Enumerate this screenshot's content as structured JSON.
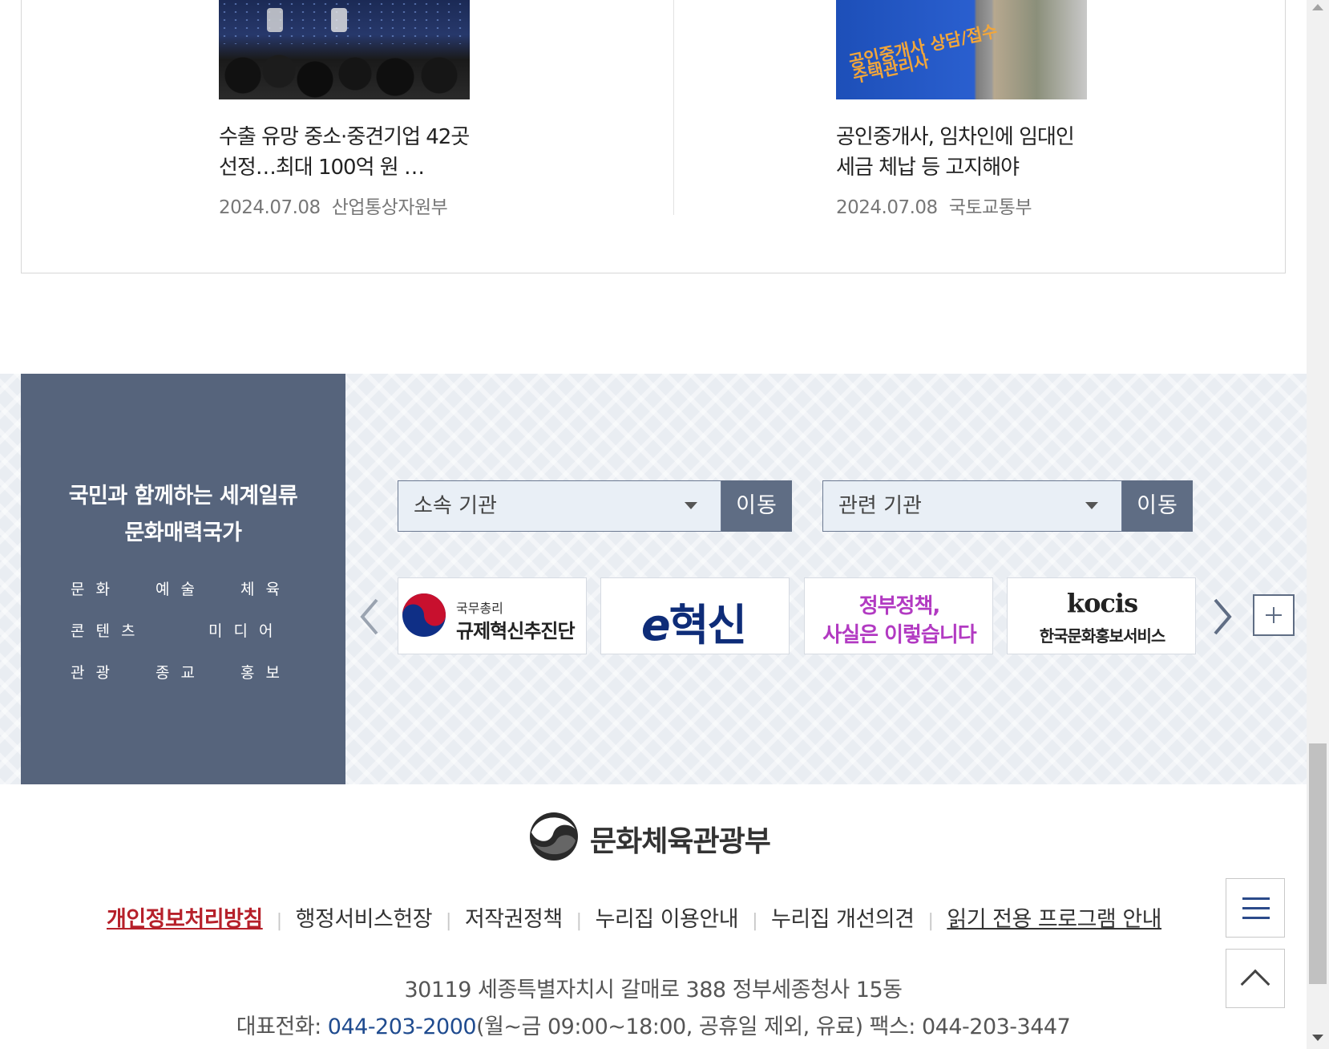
{
  "news": {
    "items": [
      {
        "title": "수출 유망 중소·중견기업 42곳 선정…최대 100억 원 …",
        "date": "2024.07.08",
        "source": "산업통상자원부"
      },
      {
        "title": "공인중개사, 임차인에 임대인 세금 체납 등 고지해야",
        "date": "2024.07.08",
        "source": "국토교통부",
        "image_sign_line1": "공인중개사 상담/접수",
        "image_sign_line2": "주택관리사"
      }
    ]
  },
  "slogan": {
    "line1": "국민과 함께하는 세계일류",
    "line2": "문화매력국가",
    "keywords": {
      "row1": [
        "문화",
        "예술",
        "체육"
      ],
      "row2": [
        "콘텐츠",
        "미디어"
      ],
      "row3": [
        "관광",
        "종교",
        "홍보"
      ]
    }
  },
  "selects": {
    "affiliated": {
      "value": "소속 기관",
      "button": "이동"
    },
    "related": {
      "value": "관련 기관",
      "button": "이동"
    }
  },
  "banners": {
    "b1": {
      "small": "국무총리",
      "big": "규제혁신추진단"
    },
    "b2": {
      "e": "e",
      "text": "혁신"
    },
    "b3": {
      "line1": "정부정책,",
      "line2": "사실은 이렇습니다"
    },
    "b4": {
      "logo": "kocis",
      "sub": "한국문화홍보서비스"
    }
  },
  "footer": {
    "ministry": "문화체육관광부",
    "links": {
      "privacy": "개인정보처리방침",
      "service": "행정서비스헌장",
      "copyright": "저작권정책",
      "usage": "누리집 이용안내",
      "feedback": "누리집 개선의견",
      "reader": "읽기 전용 프로그램 안내"
    },
    "address": "30119 세종특별자치시 갈매로 388 정부세종청사 15동",
    "tel_label": "대표전화: ",
    "tel_number": "044-203-2000",
    "tel_rest": "(월~금 09:00~18:00, 공휴일 제외, 유료)  팩스: 044-203-3447"
  },
  "colors": {
    "slogan_panel": "#56647c",
    "go_button": "#5f6d84",
    "privacy_link": "#b6202a",
    "phone": "#1f4b8f",
    "menu_icon": "#2b4a8a"
  },
  "icons": {
    "prev": "chevron-left-icon",
    "next": "chevron-right-icon",
    "more": "plus-icon",
    "menu": "hamburger-icon",
    "top": "chevron-up-icon",
    "select": "caret-down-icon"
  }
}
